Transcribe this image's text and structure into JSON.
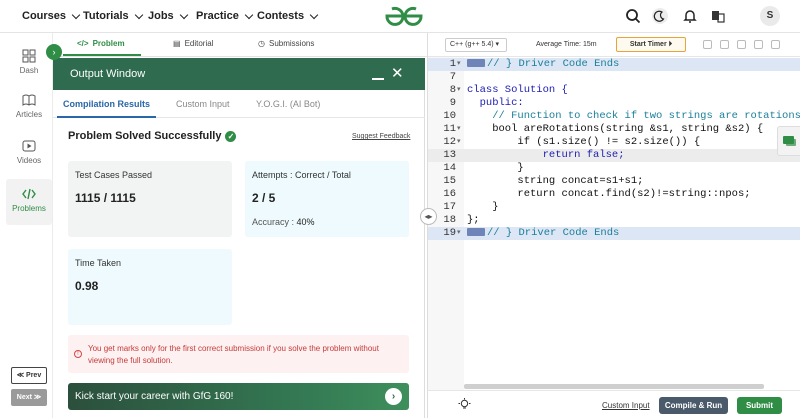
{
  "nav": {
    "items": [
      "Courses",
      "Tutorials",
      "Jobs",
      "Practice",
      "Contests"
    ],
    "avatar_letter": "S"
  },
  "rail": {
    "items": [
      "Dash",
      "Articles",
      "Videos",
      "Problems"
    ],
    "prev": "≪ Prev",
    "next": "Next ≫"
  },
  "problem_tabs": [
    "Problem",
    "Editorial",
    "Submissions"
  ],
  "output": {
    "title": "Output Window",
    "tabs": [
      "Compilation Results",
      "Custom Input",
      "Y.O.G.I. (AI Bot)"
    ],
    "status": "Problem Solved Successfully",
    "suggest": "Suggest Feedback",
    "test_cases_label": "Test Cases Passed",
    "test_cases_value": "1115 / 1115",
    "attempts_label": "Attempts : Correct / Total",
    "attempts_value": "2 / 5",
    "accuracy_label": "Accuracy :",
    "accuracy_value": "40%",
    "time_label": "Time Taken",
    "time_value": "0.98",
    "warning": "You get marks only for the first correct submission if you solve the problem without viewing the full solution.",
    "banner": "Kick start your career with GfG 160!"
  },
  "editor_toolbar": {
    "language": "C++ (g++ 5.4)",
    "avg_time": "Average Time: 15m",
    "timer": "Start Timer"
  },
  "code_lines": [
    {
      "n": "1",
      "t": "// } Driver Code Ends",
      "fold": true
    },
    {
      "n": "7",
      "t": ""
    },
    {
      "n": "8",
      "t": "class Solution {",
      "fold": true
    },
    {
      "n": "9",
      "t": "  public:"
    },
    {
      "n": "10",
      "t": "    // Function to check if two strings are rotations"
    },
    {
      "n": "11",
      "t": "    bool areRotations(string &s1, string &s2) {",
      "fold": true
    },
    {
      "n": "12",
      "t": "        if (s1.size() != s2.size()) {",
      "fold": true
    },
    {
      "n": "13",
      "t": "            return false;"
    },
    {
      "n": "14",
      "t": "        }"
    },
    {
      "n": "15",
      "t": "        string concat=s1+s1;"
    },
    {
      "n": "16",
      "t": "        return concat.find(s2)!=string::npos;"
    },
    {
      "n": "17",
      "t": "    }"
    },
    {
      "n": "18",
      "t": "};"
    },
    {
      "n": "19",
      "t": "// } Driver Code Ends",
      "fold": true
    }
  ],
  "bottom": {
    "custom_input": "Custom Input",
    "compile_run": "Compile & Run",
    "submit": "Submit"
  },
  "colors": {
    "brand_green": "#2f8d46",
    "header_green": "#2e6b4f",
    "tab_blue": "#2a67a8"
  }
}
